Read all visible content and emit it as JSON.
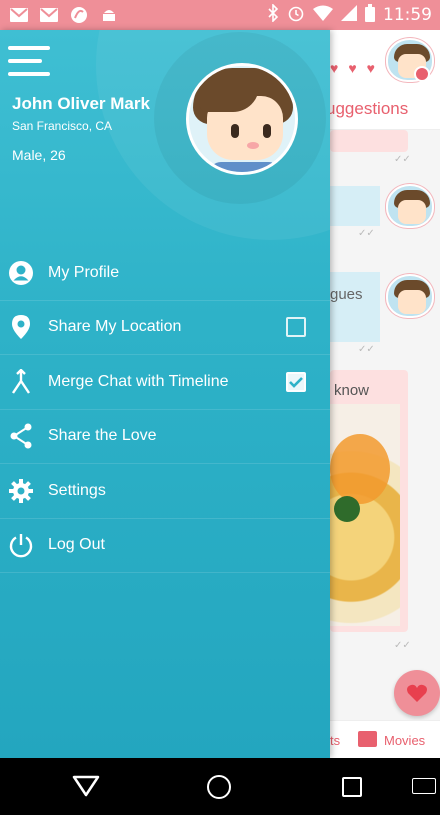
{
  "status_bar": {
    "time": "11:59",
    "icons_left": [
      "gmail-icon",
      "gmail-icon",
      "app-icon",
      "android-icon"
    ],
    "icons_right": [
      "bluetooth-icon",
      "alarm-icon",
      "wifi-icon",
      "signal-icon",
      "battery-icon"
    ]
  },
  "drawer": {
    "user": {
      "name": "John Oliver Mark",
      "location": "San Francisco, CA",
      "meta": "Male, 26"
    },
    "menu": [
      {
        "label": "My Profile",
        "icon": "person-icon",
        "has_checkbox": false
      },
      {
        "label": "Share My Location",
        "icon": "location-pin-icon",
        "has_checkbox": true,
        "checked": false
      },
      {
        "label": "Merge Chat with Timeline",
        "icon": "merge-icon",
        "has_checkbox": true,
        "checked": true
      },
      {
        "label": "Share the Love",
        "icon": "share-icon",
        "has_checkbox": false
      },
      {
        "label": "Settings",
        "icon": "gear-icon",
        "has_checkbox": false
      },
      {
        "label": "Log Out",
        "icon": "power-icon",
        "has_checkbox": false
      }
    ],
    "colors": {
      "top": "#3fbfd3",
      "bottom": "#23a6bf"
    }
  },
  "background_app": {
    "header_tab": "uggestions",
    "message_1": "gues",
    "message_2": "know",
    "tab_partial": "ts",
    "tab_movies": "Movies",
    "accent": "#e8606e"
  }
}
